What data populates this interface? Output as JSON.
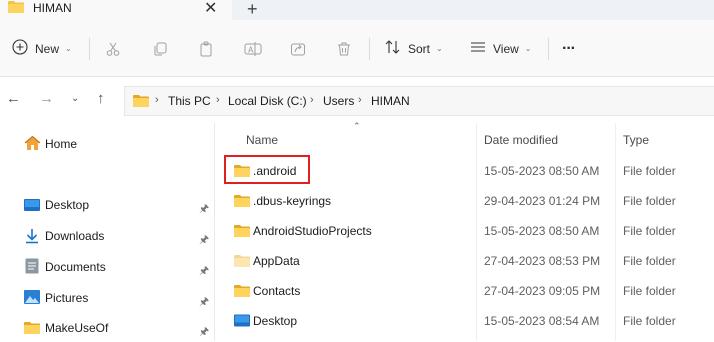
{
  "tab": {
    "title": "HIMAN",
    "close_glyph": "✕",
    "new_tab_glyph": "+"
  },
  "toolbar": {
    "new_label": "New",
    "sort_label": "Sort",
    "view_label": "View",
    "more_glyph": "···",
    "icons": [
      "plus-circle-icon",
      "cut-icon",
      "copy-icon",
      "paste-icon",
      "rename-icon",
      "share-icon",
      "delete-icon",
      "sort-icon",
      "view-icon",
      "more-icon"
    ]
  },
  "address": {
    "crumbs": [
      "This PC",
      "Local Disk (C:)",
      "Users",
      "HIMAN"
    ],
    "sep": "›"
  },
  "nav": {
    "home": "Home",
    "items": [
      {
        "label": "Desktop",
        "icon": "desktop-icon"
      },
      {
        "label": "Downloads",
        "icon": "download-icon"
      },
      {
        "label": "Documents",
        "icon": "documents-icon"
      },
      {
        "label": "Pictures",
        "icon": "pictures-icon"
      },
      {
        "label": "MakeUseOf",
        "icon": "folder-icon"
      }
    ]
  },
  "columns": {
    "name": "Name",
    "date": "Date modified",
    "type": "Type"
  },
  "rows": [
    {
      "name": ".android",
      "date": "15-05-2023 08:50 AM",
      "type": "File folder",
      "icon": "folder-icon"
    },
    {
      "name": ".dbus-keyrings",
      "date": "29-04-2023 01:24 PM",
      "type": "File folder",
      "icon": "folder-icon"
    },
    {
      "name": "AndroidStudioProjects",
      "date": "15-05-2023 08:50 AM",
      "type": "File folder",
      "icon": "folder-icon"
    },
    {
      "name": "AppData",
      "date": "27-04-2023 08:53 PM",
      "type": "File folder",
      "icon": "folder-hidden-icon"
    },
    {
      "name": "Contacts",
      "date": "27-04-2023 09:05 PM",
      "type": "File folder",
      "icon": "folder-icon"
    },
    {
      "name": "Desktop",
      "date": "15-05-2023 08:54 AM",
      "type": "File folder",
      "icon": "desktop-icon"
    }
  ],
  "colors": {
    "folder": "#f5c24c",
    "folder_dark": "#e3a92b",
    "highlight": "#e02020",
    "accent": "#1a73c8"
  }
}
